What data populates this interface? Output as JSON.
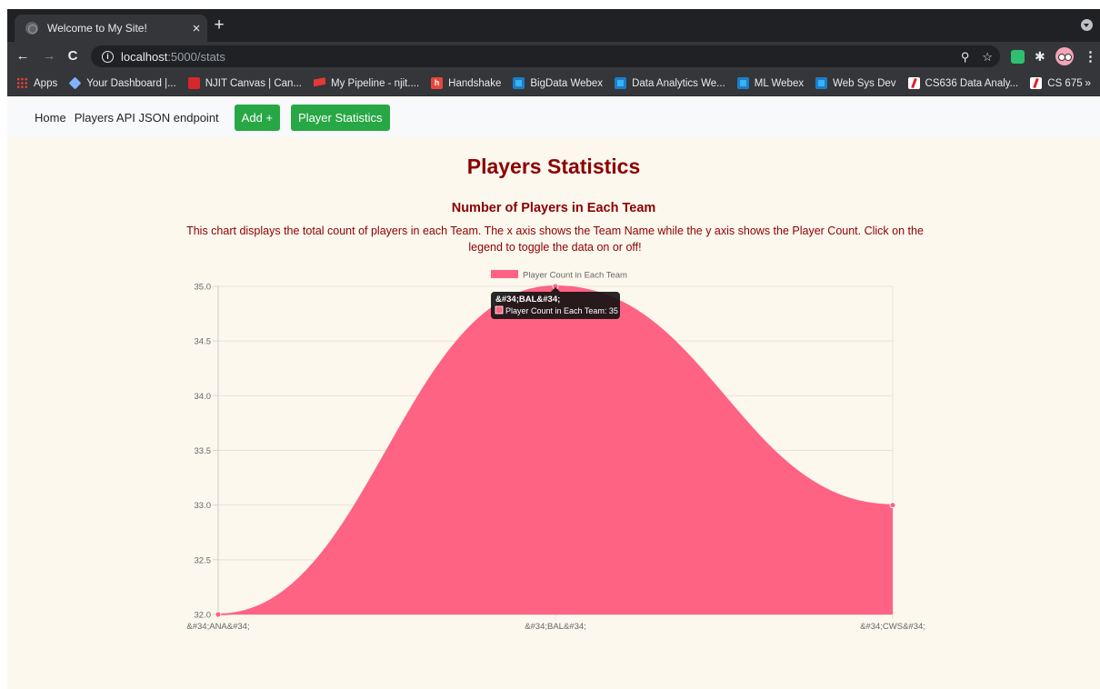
{
  "browser": {
    "tab_title": "Welcome to My Site!",
    "tab_close": "×",
    "new_tab": "+",
    "url_host": "localhost",
    "url_path": ":5000/stats",
    "nav_back": "←",
    "nav_forward": "→",
    "nav_reload": "C",
    "info_icon": "i",
    "zoom_glyph": "⚲",
    "star_glyph": "☆",
    "puzzle_glyph": "✱",
    "menu_glyph": "⋮",
    "bookmarks": [
      {
        "label": "Apps",
        "icon": "apps-icon"
      },
      {
        "label": "Your Dashboard |...",
        "icon": "gem-icon"
      },
      {
        "label": "NJIT Canvas | Can...",
        "icon": "canvas-icon"
      },
      {
        "label": "My Pipeline - njit....",
        "icon": "pipeline-icon"
      },
      {
        "label": "Handshake",
        "icon": "handshake-icon"
      },
      {
        "label": "BigData Webex",
        "icon": "webex-icon"
      },
      {
        "label": "Data Analytics We...",
        "icon": "webex-icon"
      },
      {
        "label": "ML Webex",
        "icon": "webex-icon"
      },
      {
        "label": "Web Sys Dev",
        "icon": "webex-icon"
      },
      {
        "label": "CS636 Data Analy...",
        "icon": "slash-icon"
      },
      {
        "label": "CS 675",
        "icon": "slash-icon"
      }
    ],
    "bookmarks_more": "»"
  },
  "navbar": {
    "home": "Home",
    "api": "Players API JSON endpoint",
    "add": "Add +",
    "stats": "Player Statistics"
  },
  "page": {
    "title": "Players Statistics",
    "chart_heading": "Number of Players in Each Team",
    "description": "This chart displays the total count of players in each Team. The x axis shows the Team Name while the y axis shows the Player Count. Click on the legend to toggle the data on or off!"
  },
  "tooltip": {
    "title": "&#34;BAL&#34;",
    "body": "Player Count in Each Team: 35"
  },
  "chart_data": {
    "type": "area",
    "categories": [
      "&#34;ANA&#34;",
      "&#34;BAL&#34;",
      "&#34;CWS&#34;"
    ],
    "series": [
      {
        "name": "Player Count in Each Team",
        "values": [
          32,
          35,
          33
        ],
        "color": "#ff6384"
      }
    ],
    "ylim": [
      32.0,
      35.0
    ],
    "yticks": [
      "35.0",
      "34.5",
      "34.0",
      "33.5",
      "33.0",
      "32.5",
      "32.0"
    ],
    "grid": true,
    "legend": "top-center"
  }
}
